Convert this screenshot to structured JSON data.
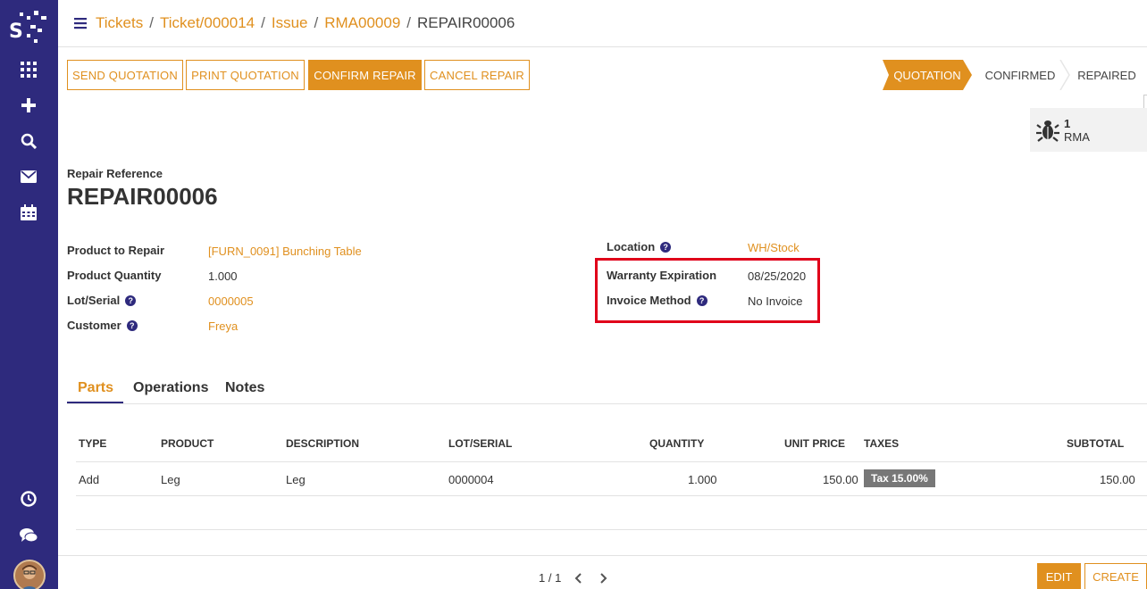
{
  "breadcrumb": [
    "Tickets",
    "Ticket/000014",
    "Issue",
    "RMA00009",
    "REPAIR00006"
  ],
  "actions": {
    "send_quotation": "SEND QUOTATION",
    "print_quotation": "PRINT QUOTATION",
    "confirm_repair": "CONFIRM REPAIR",
    "cancel_repair": "CANCEL REPAIR"
  },
  "statusbar": {
    "stages": [
      "QUOTATION",
      "CONFIRMED",
      "REPAIRED"
    ],
    "active": "QUOTATION"
  },
  "smart_button": {
    "count": "1",
    "label": "RMA",
    "icon": "bug-icon"
  },
  "form": {
    "ref_label": "Repair Reference",
    "ref_value": "REPAIR00006",
    "product_label": "Product to Repair",
    "product_value": "[FURN_0091] Bunching Table",
    "quantity_label": "Product Quantity",
    "quantity_value": "1.000",
    "lot_label": "Lot/Serial",
    "lot_value": "0000005",
    "customer_label": "Customer",
    "customer_value": "Freya",
    "location_label": "Location",
    "location_value": "WH/Stock",
    "warranty_label": "Warranty Expiration",
    "warranty_value": "08/25/2020",
    "invoice_label": "Invoice Method",
    "invoice_value": "No Invoice"
  },
  "tabs": [
    "Parts",
    "Operations",
    "Notes"
  ],
  "parts_table": {
    "headers": [
      "TYPE",
      "PRODUCT",
      "DESCRIPTION",
      "LOT/SERIAL",
      "QUANTITY",
      "UNIT PRICE",
      "TAXES",
      "SUBTOTAL"
    ],
    "rows": [
      {
        "type": "Add",
        "product": "Leg",
        "description": "Leg",
        "lot": "0000004",
        "quantity": "1.000",
        "unit_price": "150.00",
        "taxes": "Tax 15.00%",
        "subtotal": "150.00"
      }
    ]
  },
  "pager": "1 / 1",
  "footer": {
    "edit": "EDIT",
    "create": "CREATE"
  },
  "colors": {
    "sidebar": "#2e2a7d",
    "accent": "#e0901f",
    "highlight": "#e0001a"
  }
}
